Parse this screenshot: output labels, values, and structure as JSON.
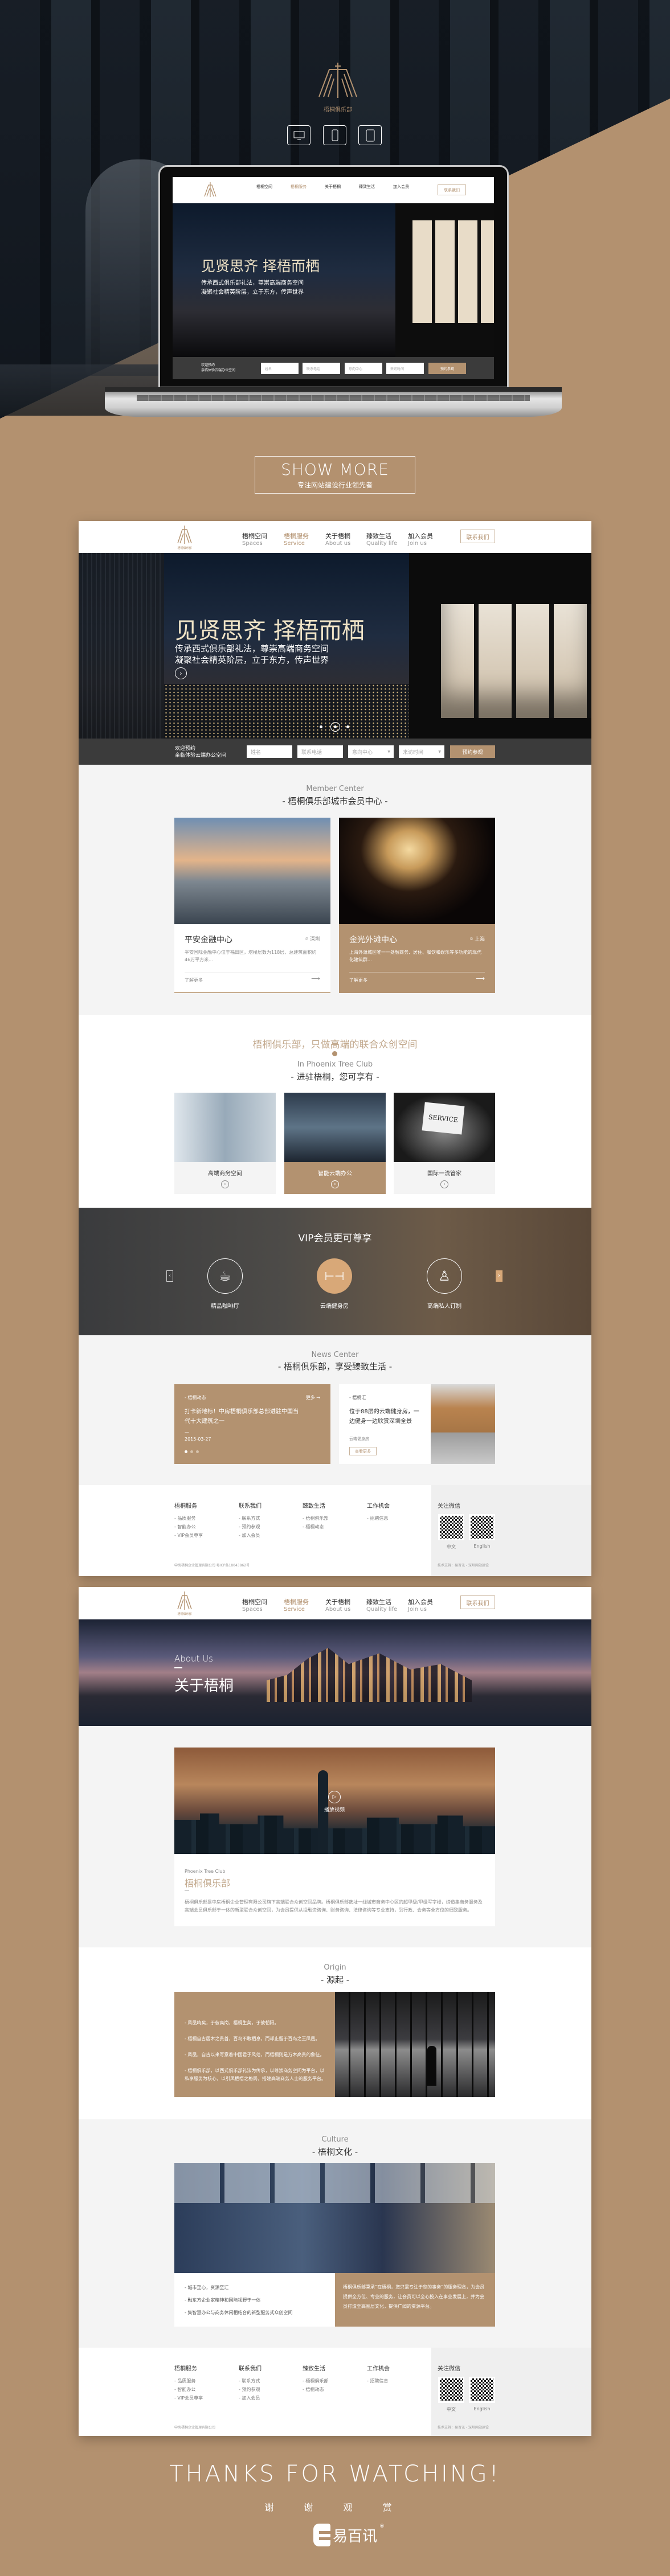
{
  "brand": {
    "name_cn": "梧桐俱乐部",
    "name_en": "PHOENIX TREE CLUB"
  },
  "nav": [
    {
      "cn": "梧桐空间",
      "en": "Spaces"
    },
    {
      "cn": "梧桐服务",
      "en": "Service"
    },
    {
      "cn": "关于梧桐",
      "en": "About us"
    },
    {
      "cn": "臻致生活",
      "en": "Quality life"
    },
    {
      "cn": "加入会员",
      "en": "Join us"
    }
  ],
  "contact_button": "联系我们",
  "hero": {
    "title": "见贤思齐 择梧而栖",
    "line1": "传承西式俱乐部礼法，尊崇高端商务空间",
    "line2": "凝聚社会精英阶层，立于东方，传声世界"
  },
  "booking": {
    "line1": "欢迎预约",
    "line2": "亲临体验云端办公空间",
    "name_ph": "姓名",
    "phone_ph": "联系电话",
    "center_ph": "意向中心",
    "time_ph": "来访时间",
    "submit": "预约参观"
  },
  "showmore": {
    "title": "SHOW MORE",
    "subtitle": "专注网站建设行业领先者"
  },
  "member": {
    "en": "Member Center",
    "cn": "- 梧桐俱乐部城市会员中心 -",
    "cards": [
      {
        "title": "平安金融中心",
        "city": "深圳",
        "desc": "平安国际金融中心位于福田区，塔楼层数为118层、总建筑面积约46万平方米...",
        "more": "了解更多"
      },
      {
        "title": "金光外滩中心",
        "city": "上海",
        "desc": "上海外滩城区唯一一处融商务、居住、餐饮和娱乐等多功能的现代化建筑群...",
        "more": "了解更多"
      }
    ]
  },
  "services": {
    "slogan": "梧桐俱乐部，只做高端的联合众创空间",
    "en": "In Phoenix Tree Club",
    "cn": "- 进驻梧桐，您可享有 -",
    "sign": "SERVICE",
    "items": [
      "高端商务空间",
      "智能云端办公",
      "国际一流管家"
    ]
  },
  "vip": {
    "title": "VIP会员更可尊享",
    "items": [
      "精品咖啡厅",
      "云端健身房",
      "高端私人订制"
    ]
  },
  "news": {
    "en": "News Center",
    "cn": "- 梧桐俱乐部，享受臻致生活 -",
    "left": {
      "category": "- 梧桐动态",
      "more": "更多 →",
      "title": "打卡新地标！中房梧桐俱乐部总部进驻中国当代十大建筑之一",
      "date": "2015-03-27"
    },
    "right": {
      "category": "- 梧桐汇",
      "title": "位于88层的云端健身房，一边健身一边欣赏深圳全景",
      "tag": "云端健身房",
      "button": "查看更多"
    }
  },
  "footer": {
    "columns": [
      {
        "title": "梧桐服务",
        "items": [
          "- 品质服务",
          "- 智能办公",
          "- VIP会员尊享"
        ]
      },
      {
        "title": "联系我们",
        "items": [
          "- 联系方式",
          "- 预约参观",
          "- 加入会员"
        ]
      },
      {
        "title": "臻致生活",
        "items": [
          "- 梧桐俱乐部",
          "- 梧桐动态"
        ]
      },
      {
        "title": "工作机会",
        "items": [
          "- 招聘信息"
        ]
      }
    ],
    "wechat_title": "关注微信",
    "qr": [
      "中文",
      "English"
    ],
    "copyright": "中房梧桐企业管理有限公司 粤ICP备18043862号",
    "copyright_short": "中房梧桐企业管理有限公司",
    "support": "技术支持：易百讯 - 深圳网站建设"
  },
  "about": {
    "banner_en": "About Us",
    "banner_cn": "关于梧桐",
    "video_label": "播放视频",
    "club_en": "Phoenix Tree Club",
    "club_cn": "梧桐俱乐部",
    "paragraph": "梧桐俱乐部是中房梧桐企业管理有限公司旗下高端联合众创空间品牌。梧桐俱乐部选址一线城市商务中心区的超甲级/甲级写字楼，缔造集商务服务及高端会员俱乐部于一体的新型联合众创空间，为会员提供从投融资咨询、财务咨询、法律咨询等专业支持，到行政、会务等全方位的细致服务。"
  },
  "origin": {
    "en": "Origin",
    "cn": "- 源起 -",
    "items": [
      "- 凤凰鸣矣，于彼高岗，梧桐生矣，于彼朝阳。",
      "- 梧桐自古居木之贵首，百鸟不敢栖息，而却止留于百鸟之王凤凰。",
      "- 凤凰，自古以来写意着中国君子风范，而梧桐则是万木高贵的象征。",
      "- 梧桐俱乐部，以西式俱乐部礼法为传承，以尊崇商务空间为平台，以私享服务为核心，以引凤栖梧之格局，搭建高端商务人士的服务平台。"
    ]
  },
  "culture": {
    "en": "Culture",
    "cn": "- 梧桐文化 -",
    "items": [
      "- 城市至心，资源至汇",
      "- 融东方企业家精神和国际视野于一体",
      "- 集智慧办公与商务休闲相结合的新型服务式众创空间"
    ],
    "statement": "梧桐俱乐部秉承“在梧桐，您只需专注于您的事务”的服务理念，为会员提供全方位、专业的服务，让会员可以全心投入在事业发展上，并为会员打造至高圈层文化，提供广阔的资源平台。"
  },
  "thanks": {
    "en": "THANKS FOR WATCHING!",
    "cn": "谢 谢 观 赏",
    "logo": "易百讯"
  },
  "colors": {
    "accent": "#b39270",
    "page_bg": "#b3916f",
    "section_gray": "#f4f4f4",
    "bar": "#3b3b3b"
  }
}
